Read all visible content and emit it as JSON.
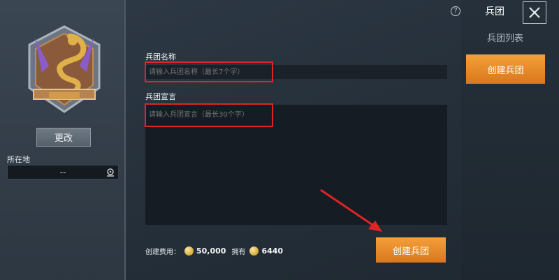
{
  "left": {
    "change_label": "更改",
    "location_label": "所在地",
    "location_value": "--"
  },
  "form": {
    "name_label": "兵团名称",
    "name_placeholder": "请输入兵团名称（最长7个字）",
    "desc_label": "兵团宣言",
    "desc_placeholder": "请输入兵团宣言（最长30个字）",
    "cost_label": "创建费用：",
    "cost_value": "50,000",
    "owned_label": "拥有",
    "owned_value": "6440",
    "create_label": "创建兵团"
  },
  "right": {
    "tab_active": "兵团",
    "tab_list": "兵团列表",
    "create_tab": "创建兵团"
  },
  "icons": {
    "help": "?",
    "close": "close-icon"
  },
  "colors": {
    "accent": "#e98a2a",
    "highlight": "#e02424"
  }
}
